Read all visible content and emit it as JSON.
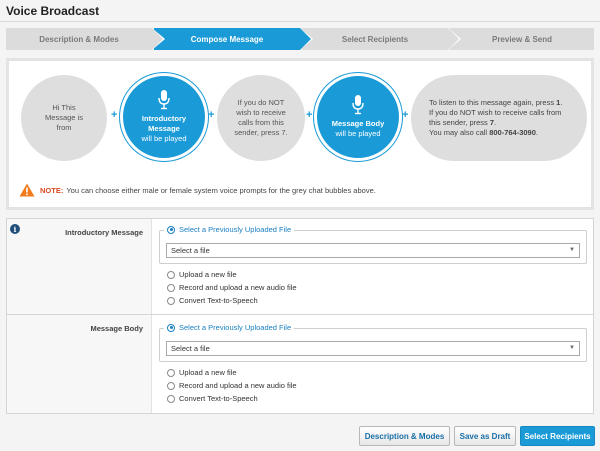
{
  "title": "Voice Broadcast",
  "steps": [
    {
      "label": "Description & Modes",
      "active": false
    },
    {
      "label": "Compose Message",
      "active": true
    },
    {
      "label": "Select Recipients",
      "active": false
    },
    {
      "label": "Preview & Send",
      "active": false
    }
  ],
  "preview": {
    "bubble1": {
      "line1": "Hi This",
      "line2": "Message is",
      "line3": "from"
    },
    "bubble2": {
      "title1": "Introductory",
      "title2": "Message",
      "sub": "will be played"
    },
    "bubble3": {
      "line1": "If you do NOT",
      "line2": "wish to receive",
      "line3": "calls from this",
      "line4": "sender, press 7."
    },
    "bubble4": {
      "title": "Message Body",
      "sub": "will be played"
    },
    "bubble5": {
      "l1a": "To listen to this message again, press",
      "l1b": "1",
      "l2": "If you do NOT wish to receive calls from",
      "l3a": "this sender, press",
      "l3b": "7",
      "l4a": "You may also call",
      "l4b": "800-764-3090"
    },
    "plus": "+",
    "note_label": "NOTE:",
    "note_text": "You can choose either male or female system voice prompts for the grey chat bubbles above."
  },
  "form": {
    "info_icon": "i",
    "intro": {
      "label": "Introductory Message",
      "legend": "Select a Previously Uploaded File",
      "select_value": "Select a file",
      "options": [
        "Upload a new file",
        "Record and upload a new audio file",
        "Convert Text-to-Speech"
      ]
    },
    "body": {
      "label": "Message Body",
      "legend": "Select a Previously Uploaded File",
      "select_value": "Select a file",
      "options": [
        "Upload a new file",
        "Record and upload a new audio file",
        "Convert Text-to-Speech"
      ]
    }
  },
  "buttons": {
    "back": "Description & Modes",
    "draft": "Save as Draft",
    "next": "Select Recipients"
  },
  "colors": {
    "accent": "#1a9bd7",
    "warning": "#d94a1e",
    "info": "#1e4e79"
  }
}
